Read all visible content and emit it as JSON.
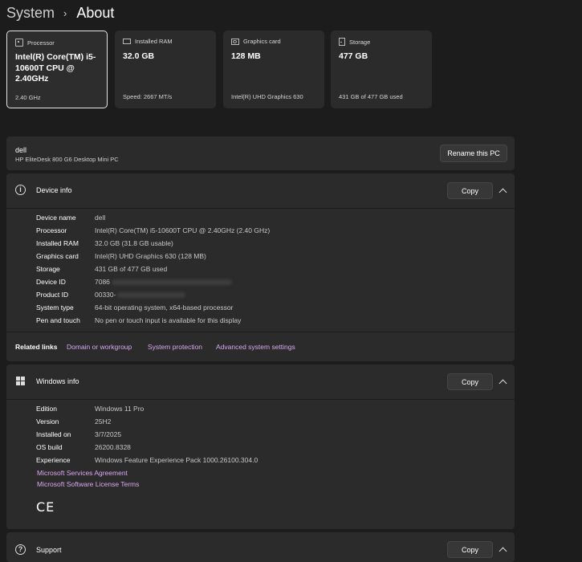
{
  "breadcrumb": {
    "parent": "System",
    "separator": "›",
    "current": "About"
  },
  "specs": [
    {
      "label": "Processor",
      "value": "Intel(R) Core(TM) i5-10600T CPU @ 2.40GHz",
      "sub": "2.40 GHz",
      "icon": "processor-icon"
    },
    {
      "label": "Installed RAM",
      "value": "32.0 GB",
      "sub": "Speed: 2667 MT/s",
      "icon": "memory-icon"
    },
    {
      "label": "Graphics card",
      "value": "128 MB",
      "sub": "Intel(R) UHD Graphics 630",
      "icon": "graphics-card-icon"
    },
    {
      "label": "Storage",
      "value": "477 GB",
      "sub": "431 GB of 477 GB used",
      "icon": "storage-icon"
    }
  ],
  "pc": {
    "name": "dell",
    "model": "HP EliteDesk 800 G6 Desktop Mini PC",
    "rename_label": "Rename this PC"
  },
  "device_info": {
    "title": "Device info",
    "copy_label": "Copy",
    "rows": [
      {
        "label": "Device name",
        "value": "dell"
      },
      {
        "label": "Processor",
        "value": "Intel(R) Core(TM) i5-10600T CPU @ 2.40GHz (2.40 GHz)"
      },
      {
        "label": "Installed RAM",
        "value": "32.0 GB (31.8 GB usable)"
      },
      {
        "label": "Graphics card",
        "value": "Intel(R) UHD Graphics 630 (128 MB)"
      },
      {
        "label": "Storage",
        "value": "431 GB of 477 GB used"
      },
      {
        "label": "Device ID",
        "value": "7086"
      },
      {
        "label": "Product ID",
        "value": "00330-"
      },
      {
        "label": "System type",
        "value": "64-bit operating system, x64-based processor"
      },
      {
        "label": "Pen and touch",
        "value": "No pen or touch input is available for this display"
      }
    ]
  },
  "related": {
    "title": "Related links",
    "links": [
      "Domain or workgroup",
      "System protection",
      "Advanced system settings"
    ]
  },
  "windows_info": {
    "title": "Windows info",
    "copy_label": "Copy",
    "rows": [
      {
        "label": "Edition",
        "value": "Windows 11 Pro"
      },
      {
        "label": "Version",
        "value": "25H2"
      },
      {
        "label": "Installed on",
        "value": "3/7/2025"
      },
      {
        "label": "OS build",
        "value": "26200.8328"
      },
      {
        "label": "Experience",
        "value": "Windows Feature Experience Pack 1000.26100.304.0"
      }
    ],
    "links": [
      "Microsoft Services Agreement",
      "Microsoft Software License Terms"
    ],
    "ce_mark": "CE"
  },
  "support": {
    "title": "Support",
    "copy_label": "Copy"
  }
}
